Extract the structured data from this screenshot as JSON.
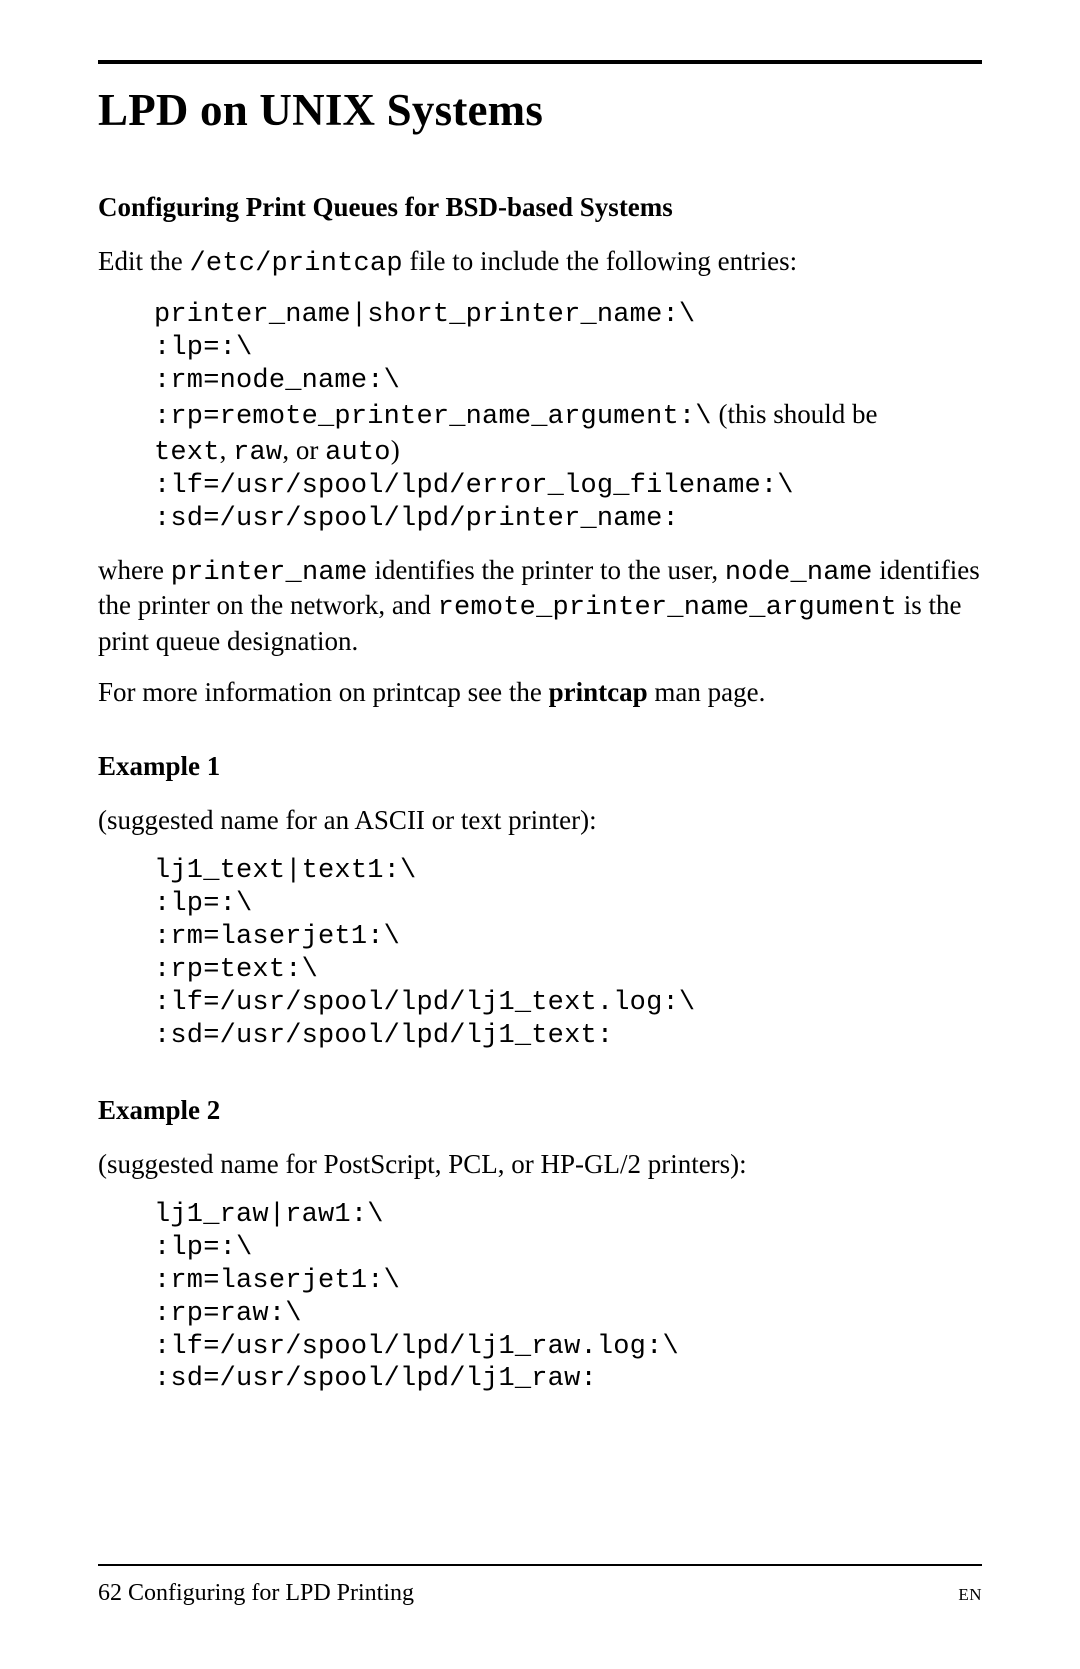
{
  "title": "LPD on UNIX Systems",
  "section1": {
    "heading": "Configuring Print Queues for BSD-based Systems",
    "intro_pre": "Edit the ",
    "intro_code": "/etc/printcap",
    "intro_post": " file to include the following entries:",
    "block": {
      "l1": "printer_name|short_printer_name:\\",
      "l2": ":lp=:\\",
      "l3": ":rm=node_name:\\",
      "l4a": ":rp=remote_printer_name_argument:\\",
      "l4b": " (this should be ",
      "l5a": "text",
      "l5b": ", ",
      "l5c": "raw",
      "l5d": ", or ",
      "l5e": "auto",
      "l5f": ")",
      "l6": ":lf=/usr/spool/lpd/error_log_filename:\\",
      "l7": ":sd=/usr/spool/lpd/printer_name:"
    },
    "explain": {
      "a": "where ",
      "b": "printer_name",
      "c": " identifies the printer to the user, ",
      "d": "node_name",
      "e": " identifies the printer on the network, and ",
      "f": "remote_printer_name_argument",
      "g": " is the print queue designation."
    },
    "more_a": "For more information on printcap see the ",
    "more_b": "printcap",
    "more_c": " man page."
  },
  "ex1": {
    "heading": "Example 1",
    "caption": "(suggested name for an ASCII or text printer):",
    "l1": "lj1_text|text1:\\",
    "l2": ":lp=:\\",
    "l3": ":rm=laserjet1:\\",
    "l4": ":rp=text:\\",
    "l5": ":lf=/usr/spool/lpd/lj1_text.log:\\",
    "l6": ":sd=/usr/spool/lpd/lj1_text:"
  },
  "ex2": {
    "heading": "Example 2",
    "caption": "(suggested name for PostScript, PCL, or HP-GL/2 printers):",
    "l1": "lj1_raw|raw1:\\",
    "l2": ":lp=:\\",
    "l3": ":rm=laserjet1:\\",
    "l4": ":rp=raw:\\",
    "l5": ":lf=/usr/spool/lpd/lj1_raw.log:\\",
    "l6": ":sd=/usr/spool/lpd/lj1_raw:"
  },
  "footer": {
    "left": "62 Configuring for LPD Printing",
    "right": "EN"
  }
}
